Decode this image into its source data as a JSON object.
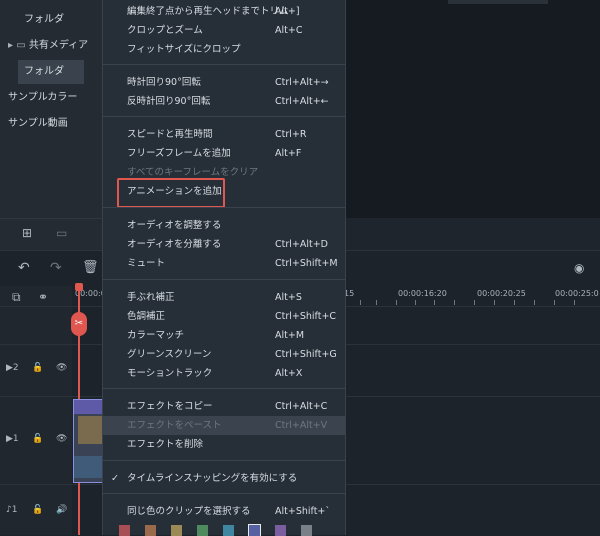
{
  "left_panel": {
    "items": [
      "フォルダ",
      "共有メディア",
      "フォルダ",
      "サンプルカラー",
      "サンプル動画"
    ]
  },
  "timeline": {
    "time_labels": [
      "00:00:0",
      "15",
      "00:00:16:20",
      "00:00:20:25",
      "00:00:25:0"
    ],
    "tracks": [
      "2",
      "1",
      "1"
    ]
  },
  "context_menu": {
    "groups": [
      [
        {
          "label": "編集終了点から再生ヘッドまでトリム",
          "shortcut": "Alt+]"
        },
        {
          "label": "クロップとズーム",
          "shortcut": "Alt+C"
        },
        {
          "label": "フィットサイズにクロップ",
          "shortcut": ""
        }
      ],
      [
        {
          "label": "時計回り90°回転",
          "shortcut": "Ctrl+Alt+→"
        },
        {
          "label": "反時計回り90°回転",
          "shortcut": "Ctrl+Alt+←"
        }
      ],
      [
        {
          "label": "スピードと再生時間",
          "shortcut": "Ctrl+R"
        },
        {
          "label": "フリーズフレームを追加",
          "shortcut": "Alt+F"
        },
        {
          "label": "すべてのキーフレームをクリア",
          "shortcut": ""
        },
        {
          "label": "アニメーションを追加",
          "shortcut": ""
        }
      ],
      [
        {
          "label": "オーディオを調整する",
          "shortcut": ""
        },
        {
          "label": "オーディオを分離する",
          "shortcut": "Ctrl+Alt+D"
        },
        {
          "label": "ミュート",
          "shortcut": "Ctrl+Shift+M"
        }
      ],
      [
        {
          "label": "手ぶれ補正",
          "shortcut": "Alt+S"
        },
        {
          "label": "色調補正",
          "shortcut": "Ctrl+Shift+C"
        },
        {
          "label": "カラーマッチ",
          "shortcut": "Alt+M"
        },
        {
          "label": "グリーンスクリーン",
          "shortcut": "Ctrl+Shift+G"
        },
        {
          "label": "モーショントラック",
          "shortcut": "Alt+X"
        }
      ],
      [
        {
          "label": "エフェクトをコピー",
          "shortcut": "Ctrl+Alt+C"
        },
        {
          "label": "エフェクトをペースト",
          "shortcut": "Ctrl+Alt+V"
        },
        {
          "label": "エフェクトを削除",
          "shortcut": ""
        }
      ],
      [
        {
          "label": "タイムラインスナッピングを有効にする",
          "shortcut": ""
        }
      ],
      [
        {
          "label": "同じ色のクリップを選択する",
          "shortcut": "Alt+Shift+`"
        }
      ]
    ],
    "check_mark": "✓",
    "colors": [
      "#a84f56",
      "#9a6a4a",
      "#9b8a55",
      "#4f8a5e",
      "#3f86a0",
      "#5561a0",
      "#7a5ea0",
      "#7a8088"
    ],
    "highlight_color": "#e0574f"
  },
  "colors": {
    "accent": "#e0574f",
    "panel": "#242b33",
    "menu": "#262e37"
  }
}
